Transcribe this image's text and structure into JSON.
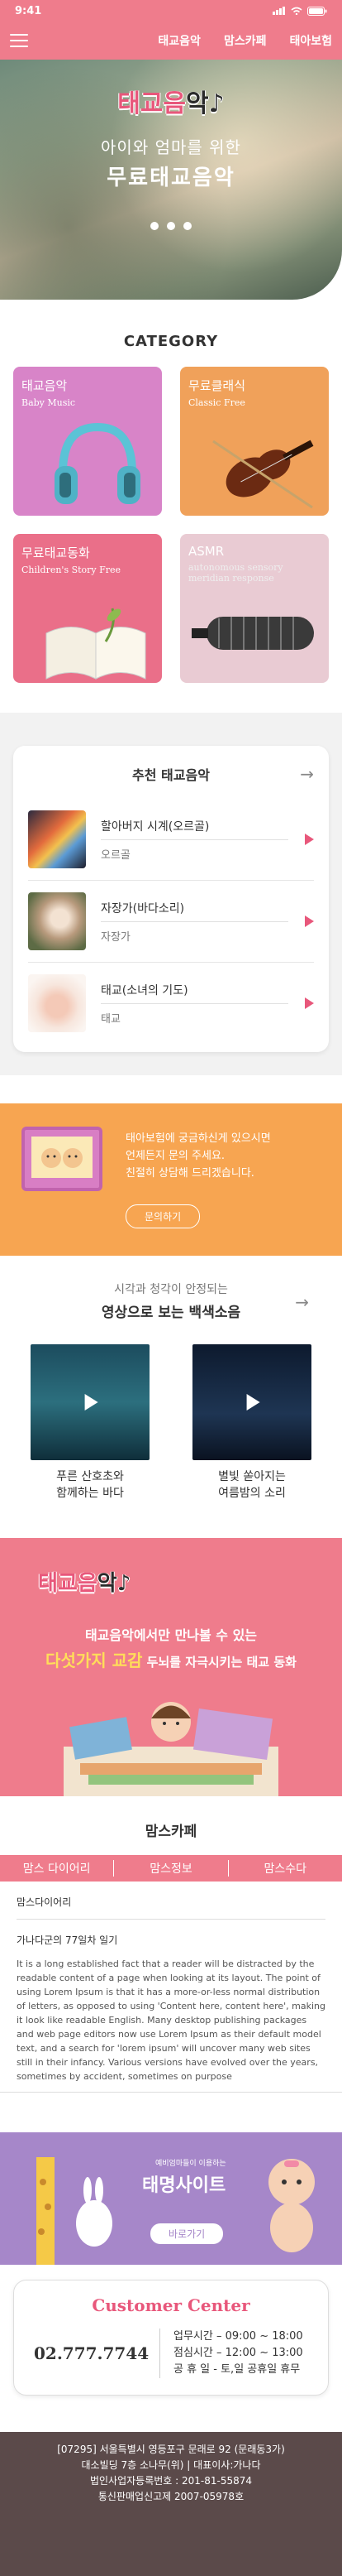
{
  "status": {
    "time": "9:41"
  },
  "header": {
    "nav": [
      "태교음악",
      "맘스카페",
      "태아보험"
    ]
  },
  "hero": {
    "logo_main": "태교음",
    "logo_note": "악",
    "subtitle": "아이와 엄마를 위한",
    "title": "무료태교음악"
  },
  "category": {
    "title": "CATEGORY",
    "items": [
      {
        "title": "태교음악",
        "subtitle": "Baby Music"
      },
      {
        "title": "무료클래식",
        "subtitle": "Classic Free"
      },
      {
        "title": "무료태교동화",
        "subtitle": "Children's Story Free"
      },
      {
        "title": "ASMR",
        "subtitle": "autonomous sensory meridian response"
      }
    ]
  },
  "recommended": {
    "title": "추천 태교음악",
    "items": [
      {
        "title": "할아버지 시계(오르골)",
        "sub": "오르골"
      },
      {
        "title": "자장가(바다소리)",
        "sub": "자장가"
      },
      {
        "title": "태교(소녀의 기도)",
        "sub": "태교"
      }
    ]
  },
  "promo": {
    "line1": "태아보험에 궁금하신게 있으시면",
    "line2": "언제든지 문의 주세요.",
    "line3": "친절히 상담해 드리겠습니다.",
    "button": "문의하기"
  },
  "video": {
    "heading1": "시각과 청각이 안정되는",
    "heading2": "영상으로 보는 백색소음",
    "items": [
      {
        "line1": "푸른 산호초와",
        "line2": "함께하는 바다"
      },
      {
        "line1": "별빛 쏟아지는",
        "line2": "여름밤의 소리"
      }
    ]
  },
  "banner": {
    "logo_main": "태교음",
    "logo_note": "악",
    "line1": "태교음악에서만 만나볼 수 있는",
    "line2_highlight": "다섯가지 교감",
    "line2_rest": "두뇌를 자극시키는 태교 동화"
  },
  "cafe": {
    "title": "맘스카페",
    "tabs": [
      "맘스 다이어리",
      "맘스정보",
      "맘스수다"
    ],
    "section": "맘스다이어리",
    "post_title": "가나다군의 77일차 일기",
    "post_body": "It is a long established fact that a reader will be distracted by the readable content of a page when looking at its layout. The point of using Lorem Ipsum is that it has a more-or-less normal distribution of letters, as opposed to using 'Content here, content here', making it look like readable English. Many desktop publishing packages and web page editors now use Lorem Ipsum as their default model text, and a search for 'lorem ipsum' will uncover many web sites still in their infancy. Various versions have evolved over the years, sometimes by accident, sometimes on purpose"
  },
  "purple_banner": {
    "small": "예비엄마들이 이용하는",
    "big": "태명사이트",
    "button": "바로가기"
  },
  "customer_center": {
    "title": "Customer Center",
    "phone": "02.777.7744",
    "hours": [
      "업무시간 – 09:00 ~ 18:00",
      "점심시간 – 12:00 ~ 13:00",
      "공 휴 일 - 토,일 공휴일 휴무"
    ]
  },
  "footer": {
    "lines": [
      "[07295] 서울특별시 영등포구 문래로 92 (문래동3가)",
      "대소빌딩 7층 소나무(위) | 대표이사:가나다",
      "법인사업자등록번호 : 201-81-55874",
      "통신판매업신고제 2007-05978호"
    ]
  },
  "colors": {
    "pink": "#ef7c8c",
    "accent": "#e8577b",
    "orange": "#f7a551",
    "purple": "#a687c9",
    "footer": "#5b4a4a"
  }
}
